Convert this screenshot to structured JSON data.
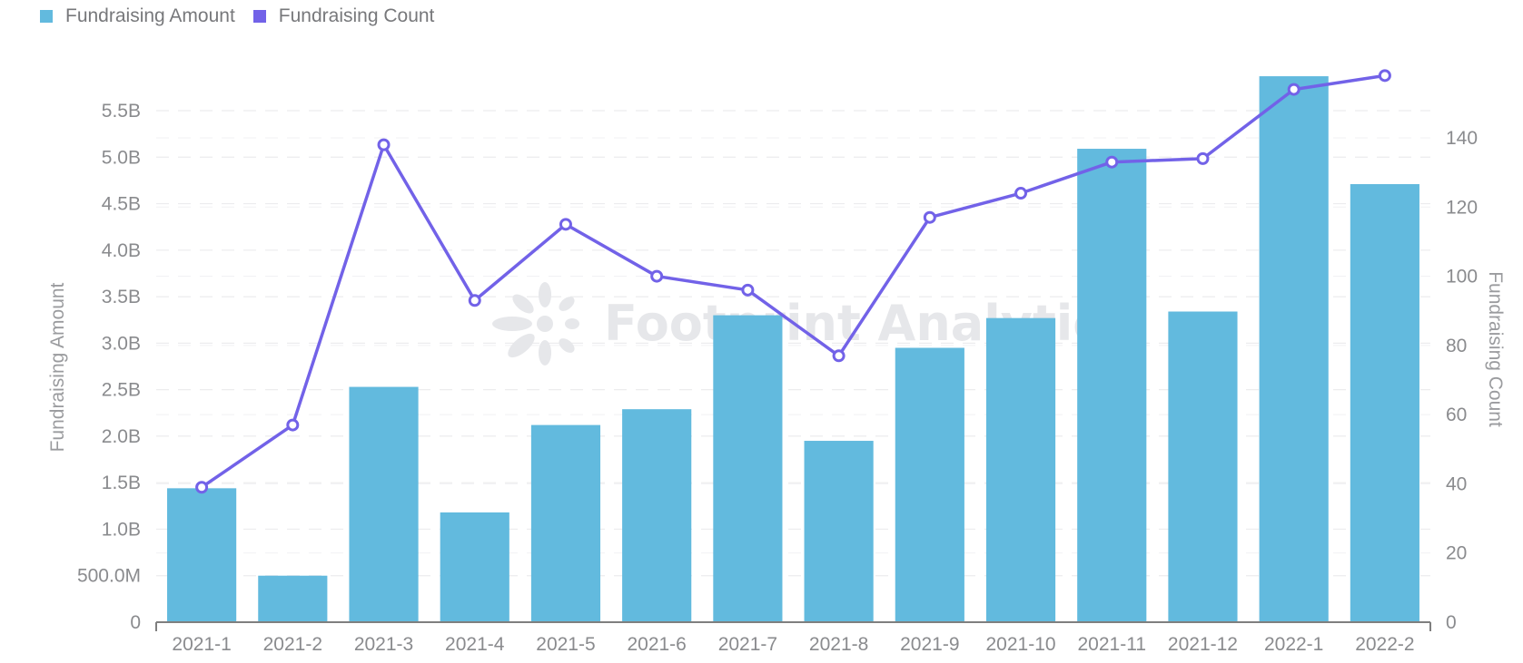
{
  "legend": {
    "items": [
      {
        "label": "Fundraising Amount",
        "color": "#62bade"
      },
      {
        "label": "Fundraising Count",
        "color": "#7262e8"
      }
    ]
  },
  "watermark": {
    "text": "Footprint Analytics"
  },
  "chart_data": {
    "type": "bar+line",
    "title": "",
    "xlabel": "",
    "ylabel": "Fundraising Amount",
    "y2label": "Fundraising Count",
    "categories": [
      "2021-1",
      "2021-2",
      "2021-3",
      "2021-4",
      "2021-5",
      "2021-6",
      "2021-7",
      "2021-8",
      "2021-9",
      "2021-10",
      "2021-11",
      "2021-12",
      "2022-1",
      "2022-2"
    ],
    "series": [
      {
        "name": "Fundraising Amount",
        "type": "bar",
        "axis": "left",
        "color": "#62bade",
        "values": [
          1440000000.0,
          500000000.0,
          2530000000.0,
          1180000000.0,
          2120000000.0,
          2290000000.0,
          3300000000.0,
          1950000000.0,
          2950000000.0,
          3270000000.0,
          5090000000.0,
          3340000000.0,
          5870000000.0,
          4710000000.0
        ]
      },
      {
        "name": "Fundraising Count",
        "type": "line",
        "axis": "right",
        "color": "#7262e8",
        "values": [
          39,
          57,
          138,
          93,
          115,
          100,
          96,
          77,
          117,
          124,
          133,
          134,
          154,
          158
        ]
      }
    ],
    "ylim": [
      0,
      5500000000
    ],
    "y_ticks": [
      0,
      500000000,
      1000000000,
      1500000000,
      2000000000,
      2500000000,
      3000000000,
      3500000000,
      4000000000,
      4500000000,
      5000000000,
      5500000000
    ],
    "y_tick_labels": [
      "0",
      "500.0M",
      "1.0B",
      "1.5B",
      "2.0B",
      "2.5B",
      "3.0B",
      "3.5B",
      "4.0B",
      "4.5B",
      "5.0B",
      "5.5B"
    ],
    "y2lim": [
      0,
      140
    ],
    "y2_ticks": [
      0,
      20,
      40,
      60,
      80,
      100,
      120,
      140
    ],
    "y2_tick_labels": [
      "0",
      "20",
      "40",
      "60",
      "80",
      "100",
      "120",
      "140"
    ],
    "grid": true,
    "legend_position": "top-left"
  }
}
